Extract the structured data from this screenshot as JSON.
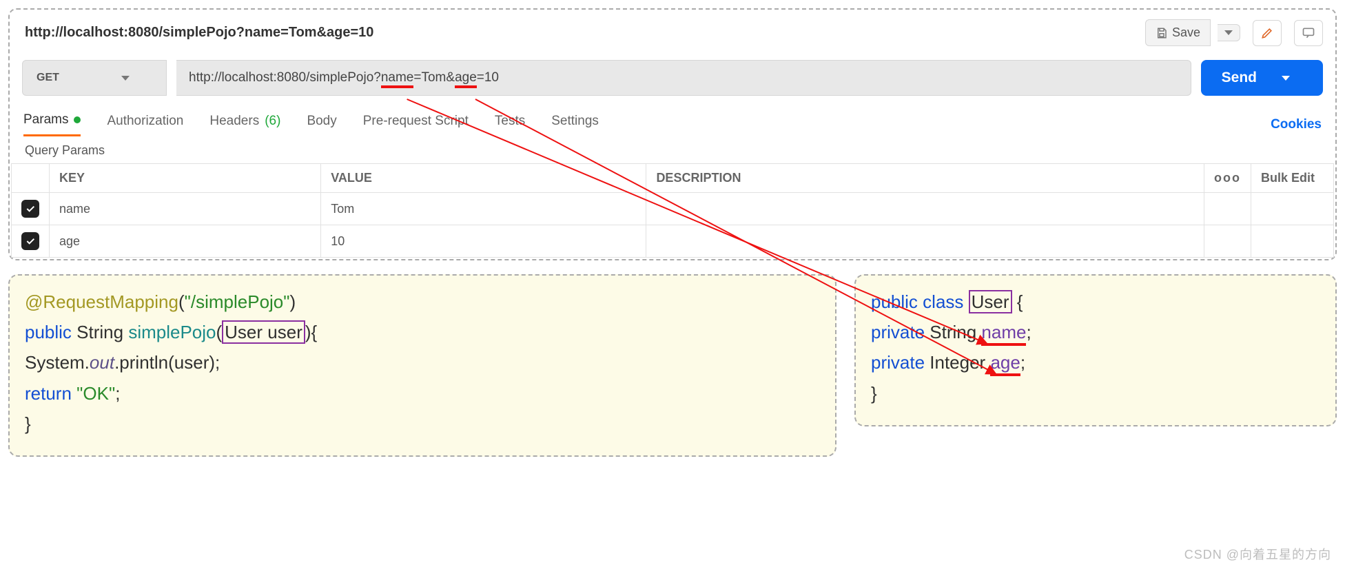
{
  "titlebar": {
    "url": "http://localhost:8080/simplePojo?name=Tom&age=10",
    "save_label": "Save"
  },
  "request": {
    "method": "GET",
    "url_prefix": "http://localhost:8080/simplePojo?",
    "p1k": "name",
    "p1v": "=Tom",
    "amp": "&",
    "p2k": "age",
    "p2v": "=10",
    "send_label": "Send"
  },
  "tabs": {
    "params": "Params",
    "auth": "Authorization",
    "headers": "Headers ",
    "headers_count": "(6)",
    "body": "Body",
    "prereq": "Pre-request Script",
    "tests": "Tests",
    "settings": "Settings",
    "cookies": "Cookies"
  },
  "query": {
    "label": "Query Params",
    "hdr_key": "KEY",
    "hdr_val": "VALUE",
    "hdr_desc": "DESCRIPTION",
    "hdr_more": "ooo",
    "hdr_bulk": "Bulk Edit",
    "rows": [
      {
        "key": "name",
        "val": "Tom"
      },
      {
        "key": "age",
        "val": "10"
      }
    ]
  },
  "code_left": {
    "l1a": "@RequestMapping",
    "l1b": "(",
    "l1c": "\"/simplePojo\"",
    "l1d": ")",
    "l2a": "public",
    "l2b": " String ",
    "l2c": "simplePojo",
    "l2d": "(",
    "l2e": "User user",
    "l2f": "){",
    "l3a": "    System.",
    "l3b": "out",
    "l3c": ".println(user);",
    "l4a": "    ",
    "l4b": "return",
    "l4c": " ",
    "l4d": "\"OK\"",
    "l4e": ";",
    "l5": "}"
  },
  "code_right": {
    "l1a": "public",
    "l1b": " ",
    "l1c": "class",
    "l1d": " ",
    "l1e": "User",
    "l1f": " {",
    "l2a": "    ",
    "l2b": "private",
    "l2c": " String ",
    "l2d": "name",
    "l2e": ";",
    "l3a": "    ",
    "l3b": "private",
    "l3c": " Integer ",
    "l3d": "age",
    "l3e": ";",
    "l4": "}"
  },
  "watermark": "CSDN @向着五星的方向"
}
